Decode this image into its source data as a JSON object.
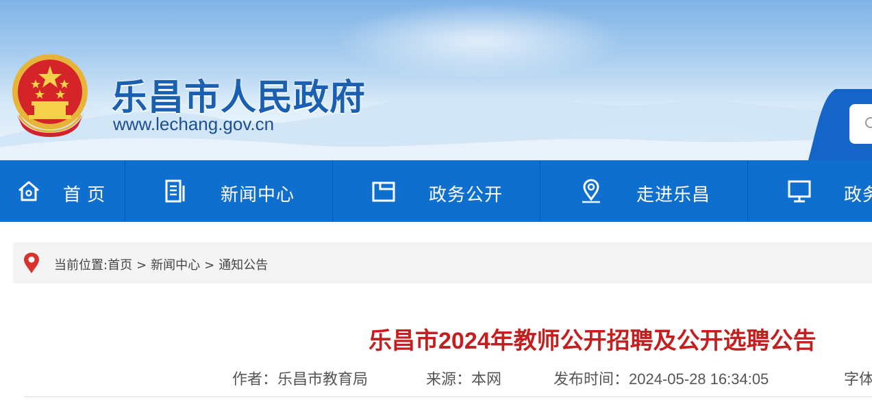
{
  "header": {
    "site_title": "乐昌市人民政府",
    "site_url": "www.lechang.gov.cn",
    "emblem_icon": "national-emblem-icon",
    "search_icon": "search-icon"
  },
  "nav": {
    "items": [
      {
        "label": "首 页",
        "icon": "home-icon"
      },
      {
        "label": "新闻中心",
        "icon": "news-icon"
      },
      {
        "label": "政务公开",
        "icon": "folder-icon"
      },
      {
        "label": "走进乐昌",
        "icon": "location-icon"
      },
      {
        "label": "政务",
        "icon": "monitor-icon"
      }
    ]
  },
  "breadcrumb": {
    "prefix": "当前位置:",
    "items": [
      "首页",
      "新闻中心",
      "通知公告"
    ],
    "separator": ">"
  },
  "article": {
    "title": "乐昌市2024年教师公开招聘及公开选聘公告",
    "author": "作者：乐昌市教育局",
    "source": "来源：本网",
    "published": "发布时间：2024-05-28 16:34:05",
    "font_size_label": "字体"
  },
  "colors": {
    "nav_bg": "#0f6fcf",
    "title_red": "#c41e1e",
    "brand_blue": "#1a5fb0"
  }
}
